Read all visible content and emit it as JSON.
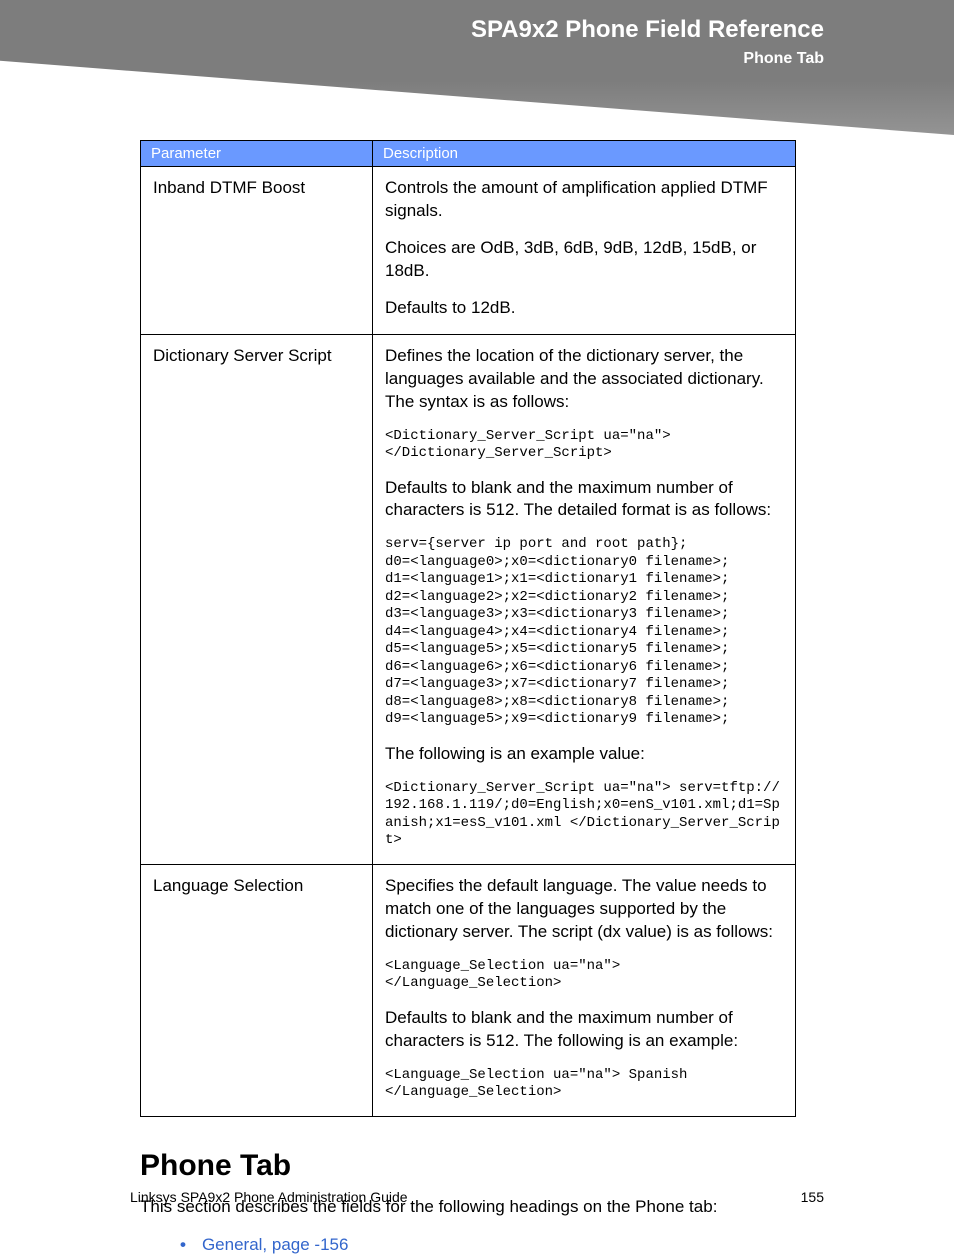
{
  "header": {
    "title": "SPA9x2 Phone Field Reference",
    "subtitle": "Phone Tab"
  },
  "table": {
    "col_param": "Parameter",
    "col_desc": "Description",
    "rows": [
      {
        "param": "Inband DTMF Boost",
        "desc": {
          "p1": "Controls the amount of amplification applied DTMF signals.",
          "p2": "Choices are OdB, 3dB, 6dB, 9dB, 12dB, 15dB, or 18dB.",
          "p3": "Defaults to 12dB."
        }
      },
      {
        "param": "Dictionary Server Script",
        "desc": {
          "p1": "Defines the location of the dictionary server, the languages available and the associated dictionary. The syntax is as follows:",
          "code1": "<Dictionary_Server_Script ua=\"na\">\n</Dictionary_Server_Script>",
          "p2": "Defaults to blank and the maximum number of characters is 512. The detailed format is as follows:",
          "code2": "serv={server ip port and root path};\nd0=<language0>;x0=<dictionary0 filename>;\nd1=<language1>;x1=<dictionary1 filename>;\nd2=<language2>;x2=<dictionary2 filename>;\nd3=<language3>;x3=<dictionary3 filename>;\nd4=<language4>;x4=<dictionary4 filename>;\nd5=<language5>;x5=<dictionary5 filename>;\nd6=<language6>;x6=<dictionary6 filename>;\nd7=<language3>;x7=<dictionary7 filename>;\nd8=<language8>;x8=<dictionary8 filename>;\nd9=<language5>;x9=<dictionary9 filename>;",
          "p3": "The following is an example value:",
          "code3": "<Dictionary_Server_Script ua=\"na\"> serv=tftp://192.168.1.119/;d0=English;x0=enS_v101.xml;d1=Spanish;x1=esS_v101.xml </Dictionary_Server_Script>"
        }
      },
      {
        "param": "Language Selection",
        "desc": {
          "p1": "Specifies the default language. The value needs to match one of the languages supported by the dictionary server. The script (dx value) is as follows:",
          "code1": "<Language_Selection ua=\"na\">\n</Language_Selection>",
          "p2": "Defaults to blank and the maximum number of characters is 512. The following is an example:",
          "code2": "<Language_Selection ua=\"na\"> Spanish\n</Language_Selection>"
        }
      }
    ]
  },
  "section": {
    "heading": "Phone Tab",
    "intro": "This section describes the fields for the following headings on the Phone tab:",
    "bullet": "General, page -156"
  },
  "footer": {
    "left": "Linksys SPA9x2 Phone Administration Guide",
    "right": "155"
  }
}
